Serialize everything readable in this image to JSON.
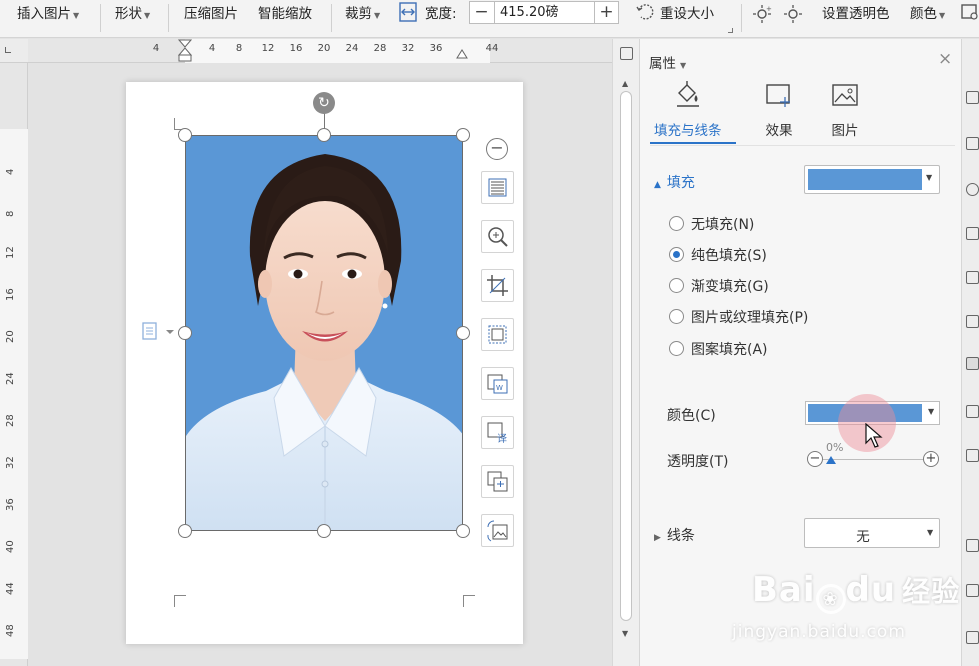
{
  "toolbar": {
    "insert_picture": "插入图片",
    "shape": "形状",
    "compress_picture": "压缩图片",
    "smart_scale": "智能缩放",
    "crop": "裁剪",
    "width_label": "宽度:",
    "width_value": "415.20磅",
    "minus": "−",
    "plus": "+",
    "reset_size": "重设大小",
    "set_transparent": "设置透明色",
    "color": "颜色"
  },
  "ruler": {
    "top_ticks": [
      "4",
      "4",
      "8",
      "12",
      "16",
      "20",
      "24",
      "28",
      "32",
      "36",
      "44"
    ],
    "left_ticks": [
      "4",
      "8",
      "12",
      "16",
      "20",
      "24",
      "28",
      "32",
      "36",
      "40",
      "44",
      "48"
    ]
  },
  "panel": {
    "title": "属性",
    "close": "×",
    "tabs": [
      {
        "label": "填充与线条",
        "icon": "fill-bucket-icon"
      },
      {
        "label": "效果",
        "icon": "effects-icon"
      },
      {
        "label": "图片",
        "icon": "picture-icon"
      }
    ],
    "fill": {
      "heading": "填充",
      "swatch_color": "#5a97d6",
      "options": [
        {
          "label": "无填充(N)",
          "checked": false
        },
        {
          "label": "纯色填充(S)",
          "checked": true
        },
        {
          "label": "渐变填充(G)",
          "checked": false
        },
        {
          "label": "图片或纹理填充(P)",
          "checked": false
        },
        {
          "label": "图案填充(A)",
          "checked": false
        }
      ],
      "color_label": "颜色(C)",
      "transparency_label": "透明度(T)",
      "transparency_value": "0%"
    },
    "line": {
      "heading": "线条",
      "value": "无"
    }
  },
  "watermark": {
    "logo": "Bai",
    "logo2": "du",
    "logo_cn": "经验",
    "url": "jingyan.baidu.com"
  },
  "colors": {
    "accent": "#2b73c8",
    "photo_bg": "#5a97d6"
  }
}
